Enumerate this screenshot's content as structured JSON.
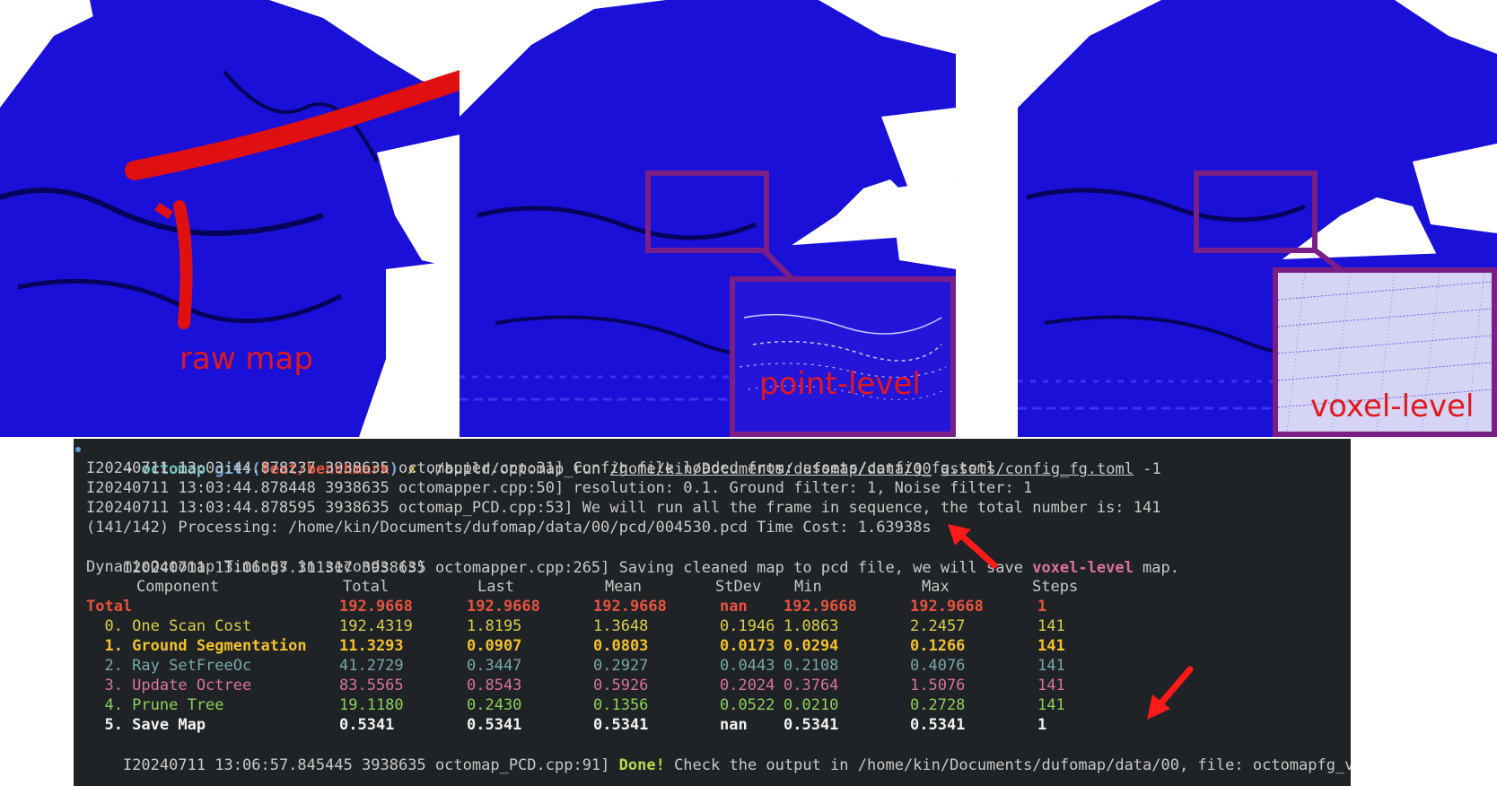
{
  "panels": [
    {
      "id": "raw",
      "label": "raw map",
      "label_color": "#e0191f"
    },
    {
      "id": "point",
      "label": "point-level",
      "label_color": "#e0191f"
    },
    {
      "id": "voxel",
      "label": "voxel-level",
      "label_color": "#e0191f"
    }
  ],
  "colors": {
    "map_blue": "#1a10d8",
    "dynamic_red": "#e01010",
    "zoom_purple": "#7a1f86",
    "terminal_bg": "#1f2326",
    "arrow_red": "#ff1a1a"
  },
  "terminal": {
    "prompt": {
      "arrow": "→",
      "dir": "octomap",
      "git_label": "git:(",
      "branch": "feat/benchmark",
      "git_close": ")",
      "dirty": "✗",
      "command": "./build/octomap_run",
      "arg_path": "/home/kin/Documents/dufomap/data/00",
      "arg_config": "assets/config_fg.toml",
      "arg_num": "-1"
    },
    "log_lines": [
      "I20240711 13:03:44.878237 3938635 octomapper.cpp:31] Config file loaded from: assets/config_fg.toml",
      "I20240711 13:03:44.878448 3938635 octomapper.cpp:50] resolution: 0.1. Ground filter: 1, Noise filter: 1",
      "I20240711 13:03:44.878595 3938635 octomap_PCD.cpp:53] We will run all the frame in sequence, the total number is: 141",
      "(141/142) Processing: /home/kin/Documents/dufomap/data/00/pcd/004530.pcd Time Cost: 1.63938s"
    ],
    "save_line": {
      "prefix": "I20240711 13:06:57.311317 3938635 octomapper.cpp:265] Saving cleaned map to pcd file, we will save ",
      "highlight": "voxel-level",
      "suffix": " map."
    },
    "timings_title": "DynamicOctomap Timings in seconds (s)",
    "table": {
      "headers": [
        "Component",
        "Total",
        "Last",
        "Mean",
        "StDev",
        "Min",
        "Max",
        "Steps"
      ],
      "rows": [
        {
          "name": "Total",
          "total": "192.9668",
          "last": "192.9668",
          "mean": "192.9668",
          "stdev": "nan",
          "min": "192.9668",
          "max": "192.9668",
          "steps": "1",
          "color": "#e8533f",
          "bold": true
        },
        {
          "name": "  0. One Scan Cost",
          "total": "192.4319",
          "last": "1.8195",
          "mean": "1.3648",
          "stdev": "0.1946",
          "min": "1.0863",
          "max": "2.2457",
          "steps": "141",
          "color": "#d8cf4a",
          "bold": false
        },
        {
          "name": "  1. Ground Segmentation",
          "total": "11.3293",
          "last": "0.0907",
          "mean": "0.0803",
          "stdev": "0.0173",
          "min": "0.0294",
          "max": "0.1266",
          "steps": "141",
          "color": "#f2c12e",
          "bold": true
        },
        {
          "name": "  2. Ray SetFreeOc",
          "total": "41.2729",
          "last": "0.3447",
          "mean": "0.2927",
          "stdev": "0.0443",
          "min": "0.2108",
          "max": "0.4076",
          "steps": "141",
          "color": "#79a8a8",
          "bold": false
        },
        {
          "name": "  3. Update Octree",
          "total": "83.5565",
          "last": "0.8543",
          "mean": "0.5926",
          "stdev": "0.2024",
          "min": "0.3764",
          "max": "1.5076",
          "steps": "141",
          "color": "#d8739a",
          "bold": false
        },
        {
          "name": "  4. Prune Tree",
          "total": "19.1180",
          "last": "0.2430",
          "mean": "0.1356",
          "stdev": "0.0522",
          "min": "0.0210",
          "max": "0.2728",
          "steps": "141",
          "color": "#8ecf5a",
          "bold": false
        },
        {
          "name": "  5. Save Map",
          "total": "0.5341",
          "last": "0.5341",
          "mean": "0.5341",
          "stdev": "nan",
          "min": "0.5341",
          "max": "0.5341",
          "steps": "1",
          "color": "#f2f2f2",
          "bold": true
        }
      ]
    },
    "done_line": {
      "prefix": "I20240711 13:06:57.845445 3938635 octomap_PCD.cpp:91] ",
      "done": "Done!",
      "suffix": " Check the output in /home/kin/Documents/dufomap/data/00, file: octomapfg_voxel_output.pcd"
    }
  }
}
